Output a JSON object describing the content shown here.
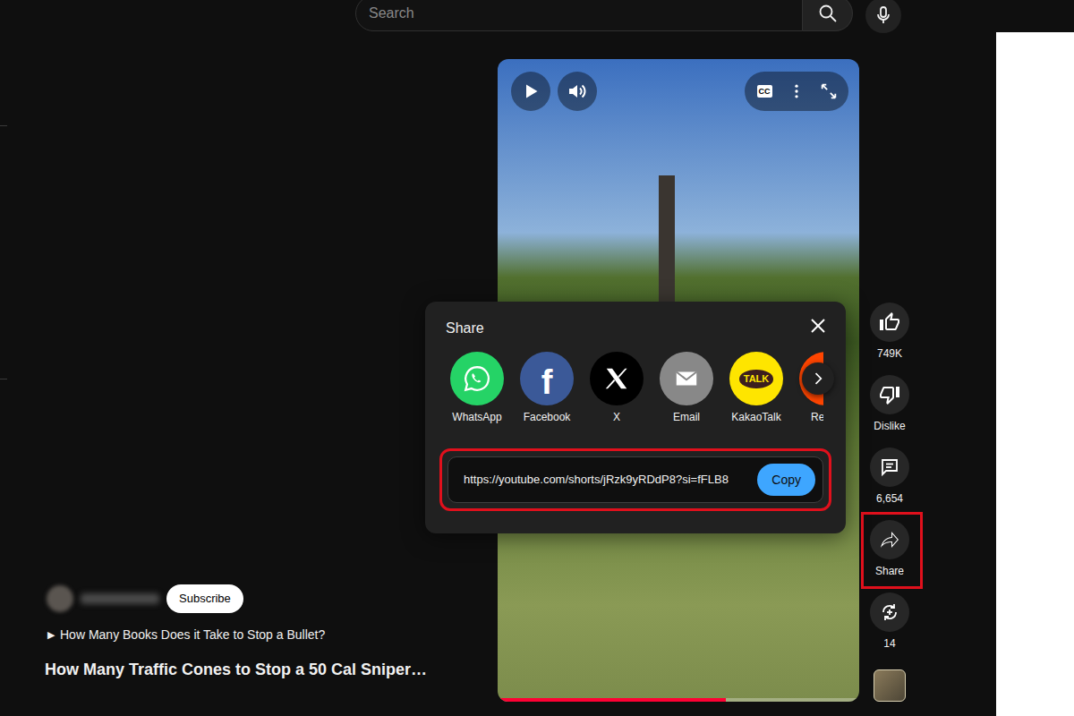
{
  "search": {
    "placeholder": "Search"
  },
  "video": {
    "progress": 0.63
  },
  "controls": {
    "cc": "CC"
  },
  "share_dialog": {
    "title": "Share",
    "targets": [
      {
        "label": "WhatsApp",
        "kind": "whatsapp",
        "color": "#25d366"
      },
      {
        "label": "Facebook",
        "kind": "facebook",
        "color": "#3b5998",
        "glyph": "f"
      },
      {
        "label": "X",
        "kind": "x",
        "color": "#000000"
      },
      {
        "label": "Email",
        "kind": "email",
        "color": "#888888"
      },
      {
        "label": "KakaoTalk",
        "kind": "kakaotalk",
        "color": "#fee500",
        "glyph": "TALK"
      },
      {
        "label": "Re",
        "kind": "reddit",
        "color": "#ff4500"
      }
    ],
    "link": {
      "text": "https://youtube.com/shorts/jRzk9yRDdP8?si=fFLB8",
      "highlighted": true
    },
    "copy": "Copy"
  },
  "actions": [
    {
      "label": "749K",
      "kind": "like",
      "highlighted": false
    },
    {
      "label": "Dislike",
      "kind": "dislike",
      "highlighted": false
    },
    {
      "label": "6,654",
      "kind": "comments",
      "highlighted": false
    },
    {
      "label": "Share",
      "kind": "share",
      "highlighted": true
    },
    {
      "label": "14",
      "kind": "remix",
      "highlighted": false
    }
  ],
  "channel": {
    "subscribe": "Subscribe"
  },
  "related": {
    "icon": "▶",
    "title": "How Many Books Does it Take to Stop a Bullet?"
  },
  "title": "How Many Traffic Cones to Stop a 50 Cal Sniper…"
}
